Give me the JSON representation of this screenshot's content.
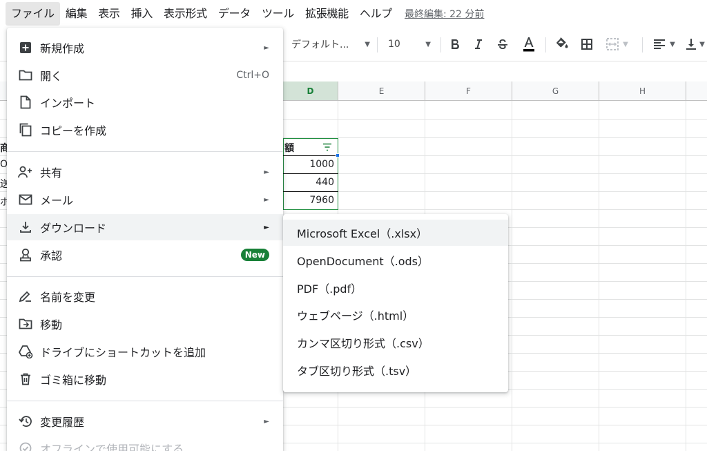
{
  "menubar": {
    "items": [
      "ファイル",
      "編集",
      "表示",
      "挿入",
      "表示形式",
      "データ",
      "ツール",
      "拡張機能",
      "ヘルプ"
    ],
    "last_edit": "最終編集: 22 分前"
  },
  "toolbar": {
    "font": "デフォルト...",
    "font_size": "10"
  },
  "grid": {
    "columns": [
      "D",
      "E",
      "F",
      "G",
      "H"
    ],
    "selected_column": "D",
    "header_cell": "額",
    "values": [
      "1000",
      "440",
      "7960"
    ],
    "left_fragments": [
      "商",
      "O",
      "送",
      "ボ"
    ]
  },
  "file_menu": {
    "items": [
      {
        "label": "新規作成",
        "icon": "add-box-icon",
        "arrow": true
      },
      {
        "label": "開く",
        "icon": "folder-icon",
        "shortcut": "Ctrl+O"
      },
      {
        "label": "インポート",
        "icon": "file-icon"
      },
      {
        "label": "コピーを作成",
        "icon": "copy-icon"
      },
      {
        "label": "共有",
        "icon": "person-add-icon",
        "arrow": true
      },
      {
        "label": "メール",
        "icon": "mail-icon",
        "arrow": true
      },
      {
        "label": "ダウンロード",
        "icon": "download-icon",
        "arrow": true
      },
      {
        "label": "承認",
        "icon": "approval-icon",
        "badge": "New"
      },
      {
        "label": "名前を変更",
        "icon": "rename-icon"
      },
      {
        "label": "移動",
        "icon": "move-icon"
      },
      {
        "label": "ドライブにショートカットを追加",
        "icon": "drive-shortcut-icon"
      },
      {
        "label": "ゴミ箱に移動",
        "icon": "trash-icon"
      },
      {
        "label": "変更履歴",
        "icon": "history-icon",
        "arrow": true
      },
      {
        "label": "オフラインで使用可能にする",
        "icon": "offline-icon"
      }
    ]
  },
  "download_submenu": {
    "items": [
      "Microsoft Excel（.xlsx）",
      "OpenDocument（.ods）",
      "PDF（.pdf）",
      "ウェブページ（.html）",
      "カンマ区切り形式（.csv）",
      "タブ区切り形式（.tsv）"
    ]
  },
  "colors": {
    "accent_green": "#188038",
    "menu_hover": "#f1f3f4",
    "selected_column_header": "#d3e3d7"
  }
}
